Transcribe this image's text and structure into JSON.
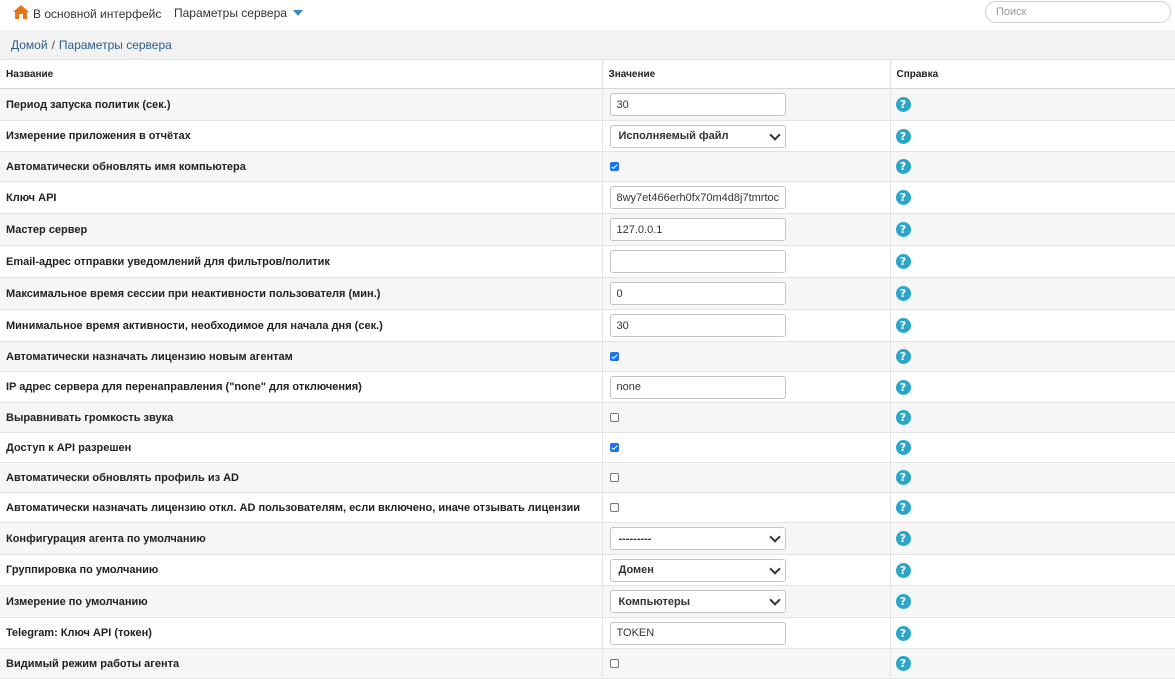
{
  "topbar": {
    "home_label": "В основной интерфейс",
    "server_menu_label": "Параметры сервера",
    "search_placeholder": "Поиск"
  },
  "breadcrumb": {
    "home": "Домой",
    "separator": "/",
    "current": "Параметры сервера"
  },
  "table": {
    "headers": {
      "name": "Название",
      "value": "Значение",
      "help": "Справка"
    },
    "rows": [
      {
        "label": "Период запуска политик (сек.)",
        "type": "text",
        "value": "30"
      },
      {
        "label": "Измерение приложения в отчётах",
        "type": "select",
        "value": "Исполняемый файл"
      },
      {
        "label": "Автоматически обновлять имя компьютера",
        "type": "checkbox",
        "checked": true
      },
      {
        "label": "Ключ API",
        "type": "text",
        "value": "8wy7et466erh0fx70m4d8j7tmrtoc"
      },
      {
        "label": "Мастер сервер",
        "type": "text",
        "value": "127.0.0.1"
      },
      {
        "label": "Email-адрес отправки уведомлений для фильтров/политик",
        "type": "text",
        "value": ""
      },
      {
        "label": "Максимальное время сессии при неактивности пользователя (мин.)",
        "type": "text",
        "value": "0"
      },
      {
        "label": "Минимальное время активности, необходимое для начала дня (сек.)",
        "type": "text",
        "value": "30"
      },
      {
        "label": "Автоматически назначать лицензию новым агентам",
        "type": "checkbox",
        "checked": true
      },
      {
        "label": "IP адрес сервера для перенаправления (\"none\" для отключения)",
        "type": "text",
        "value": "none"
      },
      {
        "label": "Выравнивать громкость звука",
        "type": "checkbox",
        "checked": false
      },
      {
        "label": "Доступ к API разрешен",
        "type": "checkbox",
        "checked": true
      },
      {
        "label": "Автоматически обновлять профиль из AD",
        "type": "checkbox",
        "checked": false
      },
      {
        "label": "Автоматически назначать лицензию откл. AD пользователям, если включено, иначе отзывать лицензии",
        "type": "checkbox",
        "checked": false
      },
      {
        "label": "Конфигурация агента по умолчанию",
        "type": "select",
        "value": "---------"
      },
      {
        "label": "Группировка по умолчанию",
        "type": "select",
        "value": "Домен"
      },
      {
        "label": "Измерение по умолчанию",
        "type": "select",
        "value": "Компьютеры"
      },
      {
        "label": "Telegram: Ключ API (токен)",
        "type": "text",
        "value": "TOKEN"
      },
      {
        "label": "Видимый режим работы агента",
        "type": "checkbox",
        "checked": false
      }
    ],
    "help_icon": "question-circle-icon"
  },
  "colors": {
    "help_icon": "#2ba6c9",
    "checkbox_checked": "#1a73e8",
    "breadcrumb_link": "#2a5d8c",
    "menu_caret": "#3a87c8"
  }
}
